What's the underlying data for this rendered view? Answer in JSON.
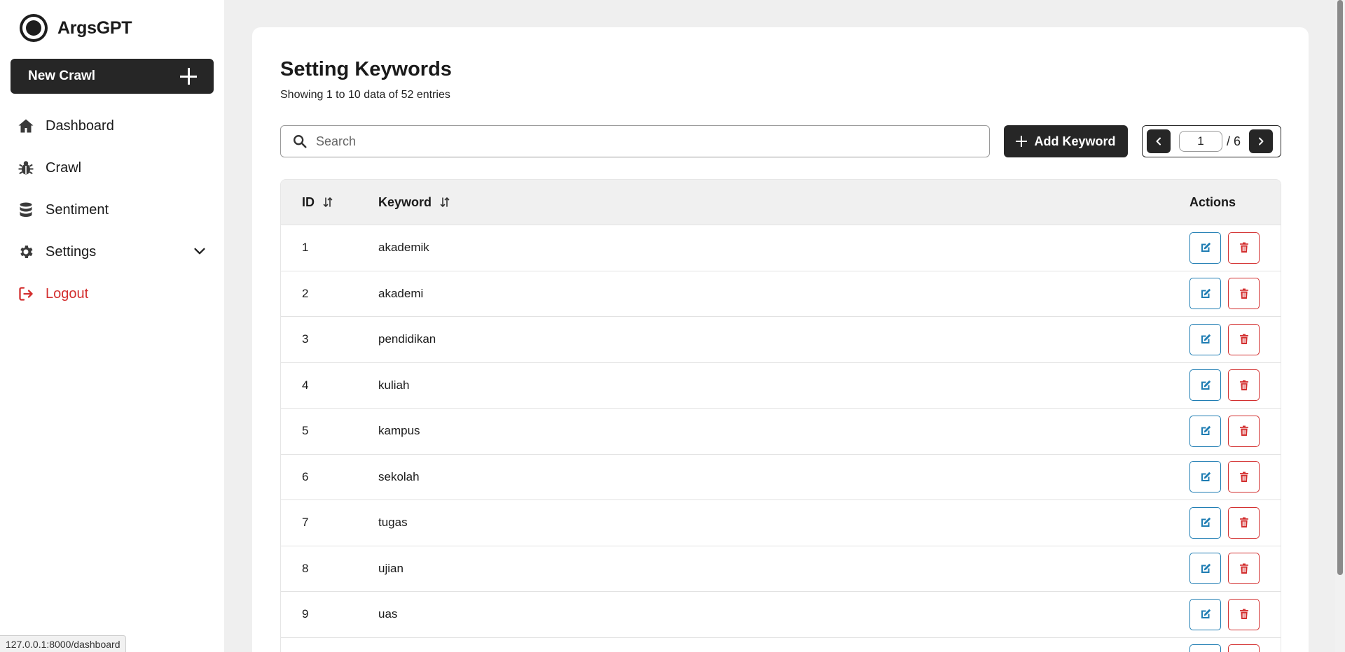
{
  "brand": {
    "name": "ArgsGPT"
  },
  "sidebar": {
    "new_crawl_label": "New Crawl",
    "items": [
      {
        "label": "Dashboard",
        "icon": "home-icon"
      },
      {
        "label": "Crawl",
        "icon": "bug-icon"
      },
      {
        "label": "Sentiment",
        "icon": "database-icon"
      },
      {
        "label": "Settings",
        "icon": "gear-icon"
      },
      {
        "label": "Logout",
        "icon": "logout-icon"
      }
    ]
  },
  "page": {
    "title": "Setting Keywords",
    "subtitle": "Showing 1 to 10 data of 52 entries"
  },
  "search": {
    "placeholder": "Search",
    "value": ""
  },
  "toolbar": {
    "add_label": "Add Keyword"
  },
  "pagination": {
    "current": "1",
    "total_label": "/ 6"
  },
  "table": {
    "headers": {
      "id": "ID",
      "keyword": "Keyword",
      "actions": "Actions"
    },
    "rows": [
      {
        "id": "1",
        "keyword": "akademik"
      },
      {
        "id": "2",
        "keyword": "akademi"
      },
      {
        "id": "3",
        "keyword": "pendidikan"
      },
      {
        "id": "4",
        "keyword": "kuliah"
      },
      {
        "id": "5",
        "keyword": "kampus"
      },
      {
        "id": "6",
        "keyword": "sekolah"
      },
      {
        "id": "7",
        "keyword": "tugas"
      },
      {
        "id": "8",
        "keyword": "ujian"
      },
      {
        "id": "9",
        "keyword": "uas"
      },
      {
        "id": "",
        "keyword": ""
      }
    ]
  },
  "status_bar": {
    "url": "127.0.0.1:8000/dashboard"
  },
  "colors": {
    "dark": "#262626",
    "edit": "#1f7db3",
    "delete": "#d32f2f"
  }
}
